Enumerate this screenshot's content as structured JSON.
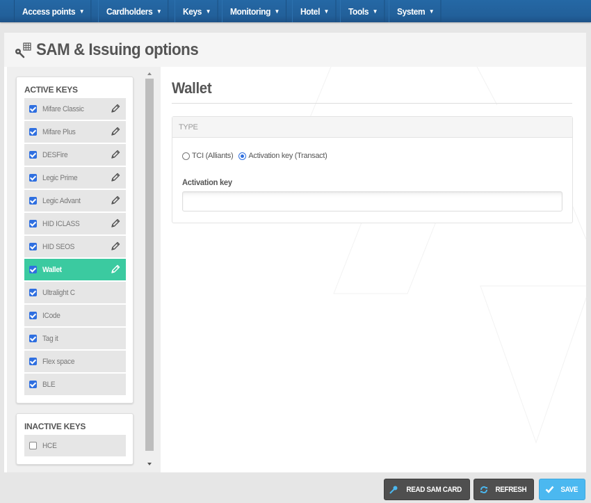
{
  "nav": {
    "items": [
      {
        "label": "Access points",
        "icon": "chevron-down"
      },
      {
        "label": "Cardholders",
        "icon": "chevron-down"
      },
      {
        "label": "Keys",
        "icon": "chevron-down"
      },
      {
        "label": "Monitoring",
        "icon": "chevron-down"
      },
      {
        "label": "Hotel",
        "icon": "chevron-down"
      },
      {
        "label": "Tools",
        "icon": "chevron-down"
      },
      {
        "label": "System",
        "icon": "chevron-down"
      }
    ],
    "chevron": "⌄"
  },
  "page": {
    "title": "SAM & Issuing options",
    "icon": "key-grid-icon"
  },
  "active_keys": {
    "title": "ACTIVE KEYS",
    "items": [
      {
        "label": "Mifare Classic",
        "checked": true,
        "editable": true,
        "selected": false
      },
      {
        "label": "Mifare Plus",
        "checked": true,
        "editable": true,
        "selected": false
      },
      {
        "label": "DESFire",
        "checked": true,
        "editable": true,
        "selected": false
      },
      {
        "label": "Legic Prime",
        "checked": true,
        "editable": true,
        "selected": false
      },
      {
        "label": "Legic Advant",
        "checked": true,
        "editable": true,
        "selected": false
      },
      {
        "label": "HID ICLASS",
        "checked": true,
        "editable": true,
        "selected": false
      },
      {
        "label": "HID SEOS",
        "checked": true,
        "editable": true,
        "selected": false
      },
      {
        "label": "Wallet",
        "checked": true,
        "editable": true,
        "selected": true
      },
      {
        "label": "Ultralight C",
        "checked": true,
        "editable": false,
        "selected": false
      },
      {
        "label": "ICode",
        "checked": true,
        "editable": false,
        "selected": false
      },
      {
        "label": "Tag it",
        "checked": true,
        "editable": false,
        "selected": false
      },
      {
        "label": "Flex space",
        "checked": true,
        "editable": false,
        "selected": false
      },
      {
        "label": "BLE",
        "checked": true,
        "editable": false,
        "selected": false
      }
    ]
  },
  "inactive_keys": {
    "title": "INACTIVE KEYS",
    "items": [
      {
        "label": "HCE",
        "checked": false,
        "editable": false,
        "selected": false
      }
    ]
  },
  "detail": {
    "title": "Wallet",
    "type_panel": {
      "header": "TYPE",
      "options": [
        {
          "label": "TCI (Alliants)",
          "selected": false
        },
        {
          "label": "Activation key (Transact)",
          "selected": true
        }
      ],
      "activation_key": {
        "label": "Activation key",
        "value": "",
        "placeholder": ""
      }
    }
  },
  "buttons": {
    "read_sam_card": "READ SAM CARD",
    "refresh": "REFRESH",
    "save": "SAVE"
  },
  "colors": {
    "nav_bg": "#2568a5",
    "selected_item": "#3bcaa0",
    "checkbox": "#2f6fe0",
    "save_button": "#4bb8f0",
    "dark_button": "#4f4f4f"
  }
}
